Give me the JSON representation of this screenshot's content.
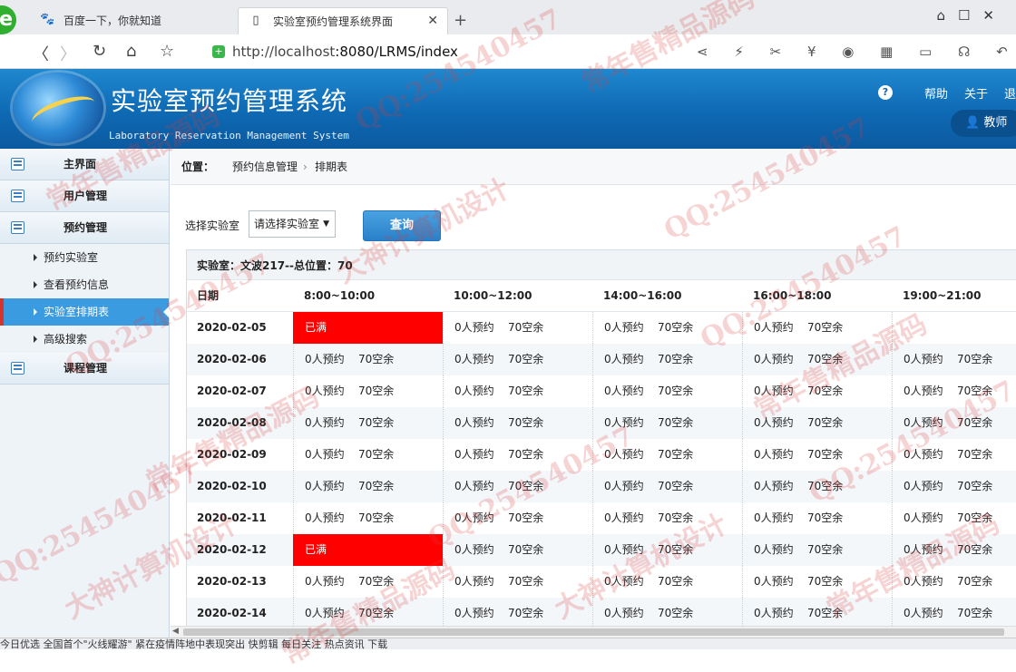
{
  "browser": {
    "tabs": [
      {
        "title": "百度一下，你就知道",
        "icon": "paw-icon",
        "active": false
      },
      {
        "title": "实验室预约管理系统界面",
        "icon": "page-icon",
        "active": true
      }
    ],
    "url_host": "http://localhost",
    "url_rest": ":8080/LRMS/index"
  },
  "app": {
    "title": "实验室预约管理系统",
    "subtitle": "Laboratory Reservation Management System",
    "header_links": [
      "帮助",
      "关于",
      "退"
    ],
    "user_label": "教师"
  },
  "sidebar": {
    "sections": [
      {
        "label": "主界面"
      },
      {
        "label": "用户管理"
      },
      {
        "label": "预约管理"
      },
      {
        "label": "课程管理"
      }
    ],
    "items": [
      {
        "label": "预约实验室",
        "active": false
      },
      {
        "label": "查看预约信息",
        "active": false
      },
      {
        "label": "实验室排期表",
        "active": true
      },
      {
        "label": "高级搜索",
        "active": false
      }
    ]
  },
  "breadcrumb": {
    "label": "位置：",
    "items": [
      "预约信息管理",
      "排期表"
    ]
  },
  "filter": {
    "label": "选择实验室",
    "select_value": "请选择实验室",
    "button": "查询"
  },
  "schedule": {
    "info": "实验室：文波217--总位置：70",
    "columns": [
      "日期",
      "8:00~10:00",
      "10:00~12:00",
      "14:00~16:00",
      "16:00~18:00",
      "19:00~21:00"
    ],
    "full_label": "已满",
    "rows": [
      {
        "date": "2020-02-05",
        "cells": [
          [
            "已满"
          ],
          [
            "0人预约",
            "70空余"
          ],
          [
            "0人预约",
            "70空余"
          ],
          [
            "0人预约",
            "70空余"
          ],
          [
            ""
          ]
        ]
      },
      {
        "date": "2020-02-06",
        "cells": [
          [
            "0人预约",
            "70空余"
          ],
          [
            "0人预约",
            "70空余"
          ],
          [
            "0人预约",
            "70空余"
          ],
          [
            "0人预约",
            "70空余"
          ],
          [
            "0人预约",
            "70空余"
          ]
        ]
      },
      {
        "date": "2020-02-07",
        "cells": [
          [
            "0人预约",
            "70空余"
          ],
          [
            "0人预约",
            "70空余"
          ],
          [
            "0人预约",
            "70空余"
          ],
          [
            "0人预约",
            "70空余"
          ],
          [
            "0人预约",
            "70空余"
          ]
        ]
      },
      {
        "date": "2020-02-08",
        "cells": [
          [
            "0人预约",
            "70空余"
          ],
          [
            "0人预约",
            "70空余"
          ],
          [
            "0人预约",
            "70空余"
          ],
          [
            "0人预约",
            "70空余"
          ],
          [
            "0人预约",
            "70空余"
          ]
        ]
      },
      {
        "date": "2020-02-09",
        "cells": [
          [
            "0人预约",
            "70空余"
          ],
          [
            "0人预约",
            "70空余"
          ],
          [
            "0人预约",
            "70空余"
          ],
          [
            "0人预约",
            "70空余"
          ],
          [
            "0人预约",
            "70空余"
          ]
        ]
      },
      {
        "date": "2020-02-10",
        "cells": [
          [
            "0人预约",
            "70空余"
          ],
          [
            "0人预约",
            "70空余"
          ],
          [
            "0人预约",
            "70空余"
          ],
          [
            "0人预约",
            "70空余"
          ],
          [
            "0人预约",
            "70空余"
          ]
        ]
      },
      {
        "date": "2020-02-11",
        "cells": [
          [
            "0人预约",
            "70空余"
          ],
          [
            "0人预约",
            "70空余"
          ],
          [
            "0人预约",
            "70空余"
          ],
          [
            "0人预约",
            "70空余"
          ],
          [
            "0人预约",
            "70空余"
          ]
        ]
      },
      {
        "date": "2020-02-12",
        "cells": [
          [
            "已满"
          ],
          [
            "0人预约",
            "70空余"
          ],
          [
            "0人预约",
            "70空余"
          ],
          [
            "0人预约",
            "70空余"
          ],
          [
            "0人预约",
            "70空余"
          ]
        ]
      },
      {
        "date": "2020-02-13",
        "cells": [
          [
            "0人预约",
            "70空余"
          ],
          [
            "0人预约",
            "70空余"
          ],
          [
            "0人预约",
            "70空余"
          ],
          [
            "0人预约",
            "70空余"
          ],
          [
            "0人预约",
            "70空余"
          ]
        ]
      },
      {
        "date": "2020-02-14",
        "cells": [
          [
            "0人预约",
            "70空余"
          ],
          [
            "0人预约",
            "70空余"
          ],
          [
            "0人预约",
            "70空余"
          ],
          [
            "0人预约",
            "70空余"
          ],
          [
            "0人预约",
            "70空余"
          ]
        ]
      }
    ]
  },
  "statusbar": "今日优选    全国首个\"火线耀游\"   紧在疫情阵地中表现突出          快剪辑     每日关注     热点资讯              下载",
  "watermarks": [
    "QQ:254540457",
    "常年售精品源码",
    "大神计算机设计"
  ]
}
